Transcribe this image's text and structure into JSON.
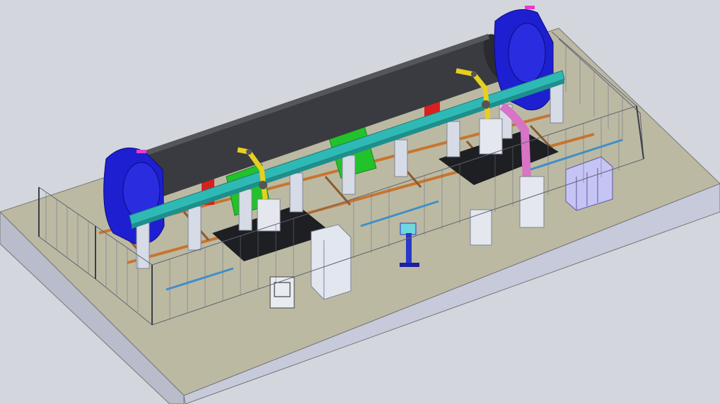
{
  "scene": {
    "description_visible_text": "",
    "colors": {
      "background": "#d3d6dc",
      "platform_top": "#bcb9a3",
      "platform_side": "#c6cadb",
      "pipe": "#3a3b40",
      "rotator": "#1d1fd0",
      "gantry_beam": "#2fb9b5",
      "column": "#d6dbe6",
      "green_unit": "#22c22a",
      "red_unit": "#d82020",
      "robot_yellow": "#e7cf20",
      "duct_pink": "#d873c6",
      "gas_cylinders": "#c5c4f4",
      "fence": "#5d6270",
      "rail": "#c7752f",
      "floor_mat": "#1e1f22",
      "cabinet": "#e2e6ee",
      "control_pedestal": "#2838c8"
    }
  }
}
